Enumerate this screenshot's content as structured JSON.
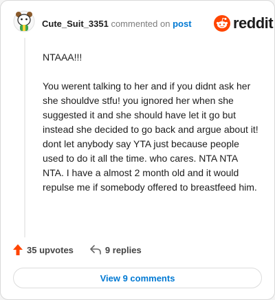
{
  "header": {
    "username": "Cute_Suit_3351",
    "commented_text": "commented on",
    "post_link": "post",
    "logo_text": "reddit"
  },
  "comment": {
    "paragraphs": [
      "NTAAA!!!",
      "",
      "You werent talking to her and if you didnt ask her she shouldve stfu! you ignored her when she suggested it and she should have let it go but instead she decided to go back and argue about it!",
      "dont let anybody say YTA just because people used to do it all the time. who cares. NTA NTA NTA. I have a almost 2 month old and it would repulse me if somebody offered to breastfeed him."
    ]
  },
  "actions": {
    "upvotes": "35 upvotes",
    "replies": "9 replies"
  },
  "view_comments_label": "View 9 comments",
  "colors": {
    "accent": "#0079d3",
    "upvote": "#ff4500",
    "reddit_orange": "#ff4500"
  }
}
